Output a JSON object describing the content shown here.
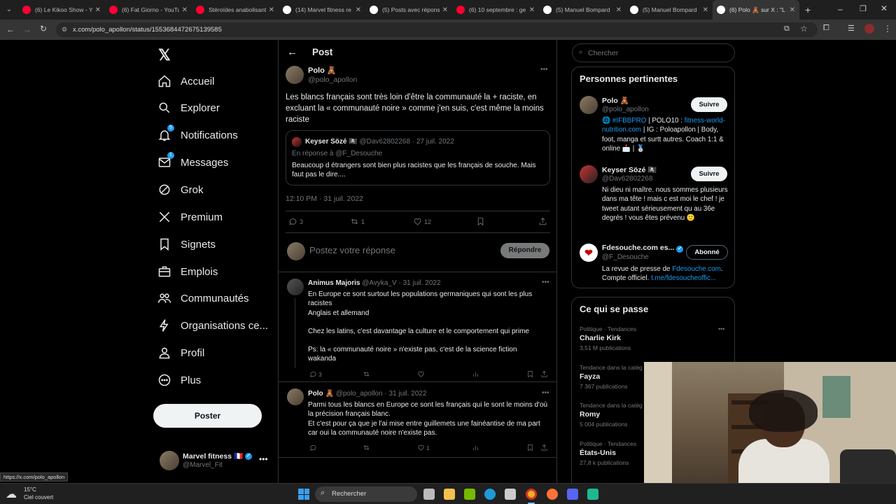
{
  "browser": {
    "tabs": [
      {
        "title": "(6) Le Kikoo Show - Y",
        "icon_color": "#ff0033"
      },
      {
        "title": "(6) Fat Giorno - YouTu",
        "icon_color": "#ff0033"
      },
      {
        "title": "Stéroïdes anabolisant",
        "icon_color": "#ff0033"
      },
      {
        "title": "(14) Marvel fitness re",
        "icon_color": "#ffffff"
      },
      {
        "title": "(5) Posts avec répons",
        "icon_color": "#ffffff"
      },
      {
        "title": "(6) 10 septembre : ge",
        "icon_color": "#ff0033"
      },
      {
        "title": "(5) Manuel Bompard",
        "icon_color": "#ffffff"
      },
      {
        "title": "(5) Manuel Bompard",
        "icon_color": "#ffffff"
      },
      {
        "title": "(6) Polo 🧸 sur X : \"L",
        "icon_color": "#ffffff"
      }
    ],
    "url": "x.com/polo_apollon/status/1553684472675139585",
    "status_url": "https://x.com/polo_apollon"
  },
  "nav": {
    "items": [
      {
        "label": "Accueil",
        "icon": "home-icon"
      },
      {
        "label": "Explorer",
        "icon": "search-icon"
      },
      {
        "label": "Notifications",
        "icon": "bell-icon",
        "badge": "5"
      },
      {
        "label": "Messages",
        "icon": "mail-icon",
        "badge": "1"
      },
      {
        "label": "Grok",
        "icon": "grok-icon"
      },
      {
        "label": "Premium",
        "icon": "x-logo-icon"
      },
      {
        "label": "Signets",
        "icon": "bookmark-icon"
      },
      {
        "label": "Emplois",
        "icon": "briefcase-icon"
      },
      {
        "label": "Communautés",
        "icon": "people-icon"
      },
      {
        "label": "Organisations ce...",
        "icon": "bolt-icon"
      },
      {
        "label": "Profil",
        "icon": "person-icon"
      },
      {
        "label": "Plus",
        "icon": "more-circle-icon"
      }
    ],
    "post_button": "Poster",
    "account": {
      "name": "Marvel fitness 🇫🇷",
      "handle": "@Marvel_Fit"
    }
  },
  "post": {
    "header": "Post",
    "author": {
      "name": "Polo 🧸",
      "handle": "@polo_apollon"
    },
    "text": "Les blancs français sont très loin d'être la communauté la + raciste, en excluant la « communauté noire » comme j'en suis, c'est même la moins raciste",
    "quote": {
      "name": "Keyser Sözé 🏴‍☠️",
      "handle": "@Dav62802268",
      "date": "· 27 juil. 2022",
      "reply_to": "En réponse à @F_Desouche",
      "text": "Beaucoup d étrangers sont bien plus racistes que les français de souche.  Mais faut pas le dire...."
    },
    "timestamp": "12:10 PM · 31 juil. 2022",
    "stats": {
      "replies": "3",
      "reposts": "1",
      "likes": "12"
    },
    "reply_placeholder": "Postez votre réponse",
    "reply_button": "Répondre"
  },
  "replies": [
    {
      "name": "Animus Majoris",
      "handle": "@Avyka_V",
      "date": "· 31 juil. 2022",
      "lines": [
        "En Europe ce sont surtout les populations germaniques qui sont les plus racistes",
        "Anglais et allemand",
        "",
        "Chez les latins, c'est davantage la culture et le comportement qui prime",
        "",
        "Ps: la « communauté noire » n'existe pas, c'est de la science fiction wakanda"
      ],
      "replies": "3",
      "likes": ""
    },
    {
      "name": "Polo 🧸",
      "handle": "@polo_apollon",
      "date": "· 31 juil. 2022",
      "lines": [
        "Parmi tous les blancs en Europe ce sont les français qui le sont le moins d'où la précision français blanc.",
        "Et c'est pour ça que je l'ai mise entre guillemets une fainéantise de ma part car oui la communauté noire n'existe pas."
      ],
      "replies": "",
      "likes": "1"
    }
  ],
  "sidebar": {
    "search_placeholder": "Chercher",
    "relevant_title": "Personnes pertinentes",
    "people": [
      {
        "name": "Polo 🧸",
        "handle": "@polo_apollon",
        "button": "Suivre",
        "bio_pre": "🌐 ",
        "bio_link1": "#IFBBPRO",
        "bio_mid": " | POLO10 : ",
        "bio_link2": "fitness-world-nutrition.com",
        "bio_post": " | IG : Poloapollon | Body, foot, manga et surtt autres. Coach 1:1 & online 📩 | 🥈"
      },
      {
        "name": "Keyser Sözé 🏴‍☠️",
        "handle": "@Dav62802268",
        "button": "Suivre",
        "bio": "Ni dieu ni maître. nous sommes plusieurs dans ma tête ! mais c est moi le chef ! je tweet autant sérieusement qu au 36e degrés ! vous êtes prévenu 🙂"
      },
      {
        "name": "Fdesouche.com es...",
        "handle": "@F_Desouche",
        "button": "Abonné",
        "bio_pre": "La revue de presse de ",
        "bio_link1": "Fdesouche.com",
        "bio_mid": ". Compte officiel. ",
        "bio_link2": "t.me/fdesoucheoffic..."
      }
    ],
    "trends_title": "Ce qui se passe",
    "trends": [
      {
        "context": "Politique · Tendances",
        "name": "Charlie Kirk",
        "count": "3,51 M publications"
      },
      {
        "context": "Tendance dans la catég",
        "name": "Fayza",
        "count": "7 367 publications"
      },
      {
        "context": "Tendance dans la catég",
        "name": "Romy",
        "count": "5 004 publications"
      },
      {
        "context": "Politique · Tendances",
        "name": "États-Unis",
        "count": "27,8 k publications"
      }
    ]
  },
  "taskbar": {
    "weather_temp": "15°C",
    "weather_desc": "Ciel couvert",
    "search": "Rechercher"
  }
}
